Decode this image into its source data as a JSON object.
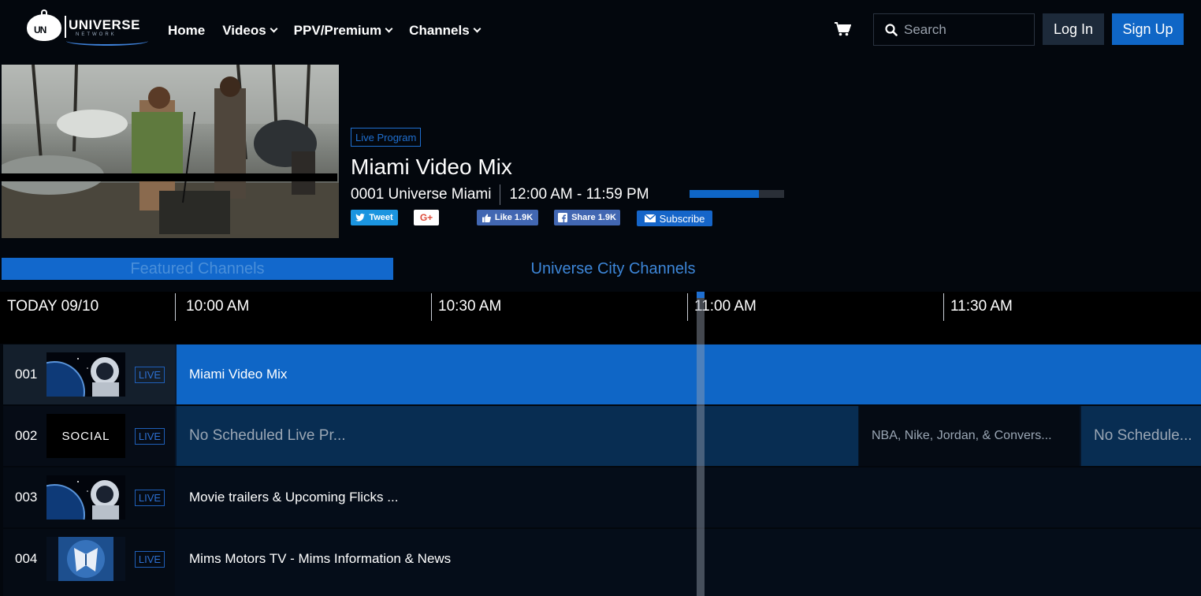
{
  "brand": {
    "logo_badge": "UN",
    "logo_word": "UNIVERSE",
    "logo_sub": "NETWORK"
  },
  "nav": {
    "items": [
      {
        "label": "Home",
        "dropdown": false
      },
      {
        "label": "Videos",
        "dropdown": true
      },
      {
        "label": "PPV/Premium",
        "dropdown": true
      },
      {
        "label": "Channels",
        "dropdown": true
      }
    ]
  },
  "header": {
    "cart_icon": "cart-icon",
    "search": {
      "placeholder": "Search",
      "value": ""
    },
    "login_label": "Log In",
    "signup_label": "Sign Up"
  },
  "now_playing": {
    "badge": "Live Program",
    "title": "Miami Video Mix",
    "channel": "0001 Universe Miami",
    "time_range": "12:00 AM - 11:59 PM",
    "progress_fraction": 0.73,
    "social": {
      "tweet": "Tweet",
      "gplus": "G+",
      "like": "Like 1.9K",
      "share": "Share 1.9K",
      "subscribe": "Subscribe"
    }
  },
  "tabs": [
    {
      "label": "Featured Channels",
      "active": true
    },
    {
      "label": "Universe City Channels",
      "active": false
    }
  ],
  "guide": {
    "date_label": "TODAY 09/10",
    "time_slots": [
      "10:00 AM",
      "10:30 AM",
      "11:00 AM",
      "11:30 AM"
    ],
    "rows": [
      {
        "number": "001",
        "logo": "space-astronaut",
        "live": "LIVE",
        "programs": [
          "Miami Video Mix"
        ]
      },
      {
        "number": "002",
        "logo": "social",
        "logo_text": "SOCIAL",
        "live": "LIVE",
        "programs": [
          "No Scheduled Live Pr...",
          "NBA, Nike, Jordan, & Convers...",
          "No Schedule..."
        ]
      },
      {
        "number": "003",
        "logo": "space-astronaut",
        "live": "LIVE",
        "programs": [
          "Movie trailers & Upcoming Flicks ..."
        ]
      },
      {
        "number": "004",
        "logo": "mims-motors",
        "live": "LIVE",
        "programs": [
          "Mims Motors TV - Mims Information & News"
        ]
      }
    ]
  },
  "colors": {
    "accent": "#0f66c6",
    "background": "#03070d",
    "row_dark": "#061427",
    "row_alt": "#071f3a"
  }
}
